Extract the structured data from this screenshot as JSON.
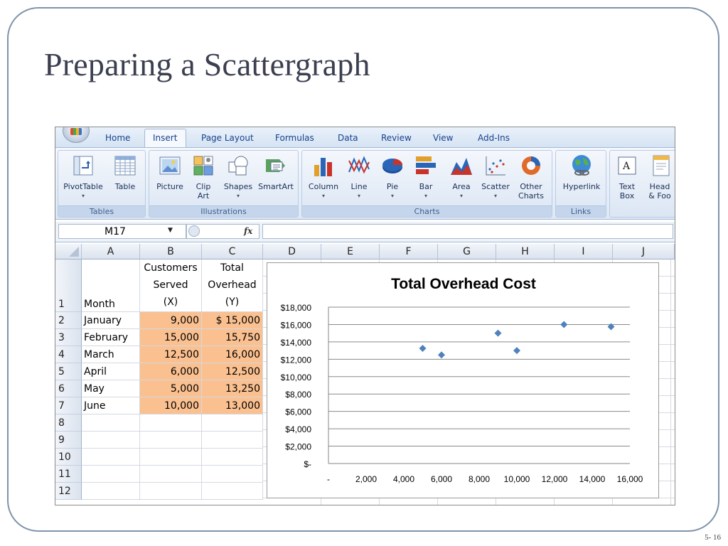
{
  "slide": {
    "title": "Preparing a Scattergraph",
    "page_number": "5- 16"
  },
  "tabs": [
    "Home",
    "Insert",
    "Page Layout",
    "Formulas",
    "Data",
    "Review",
    "View",
    "Add-Ins"
  ],
  "ribbon": {
    "groups": [
      "Tables",
      "Illustrations",
      "Charts",
      "Links"
    ],
    "pivottable": "PivotTable",
    "table": "Table",
    "picture": "Picture",
    "clipart": "Clip Art",
    "shapes": "Shapes",
    "smartart": "SmartArt",
    "column": "Column",
    "line": "Line",
    "pie": "Pie",
    "bar": "Bar",
    "area": "Area",
    "scatter": "Scatter",
    "other_charts": "Other Charts",
    "hyperlink": "Hyperlink",
    "textbox": "Text Box",
    "header_footer": "Head & Foo"
  },
  "formula_bar": {
    "name_box": "M17",
    "fx": "fx"
  },
  "columns": [
    "A",
    "B",
    "C",
    "D",
    "E",
    "F",
    "G",
    "H",
    "I",
    "J"
  ],
  "row_numbers": [
    "1",
    "2",
    "3",
    "4",
    "5",
    "6",
    "7",
    "8",
    "9",
    "10",
    "11",
    "12"
  ],
  "header_cells": {
    "a1": "Month",
    "b1": [
      "Customers",
      "Served",
      "(X)"
    ],
    "c1": [
      "Total",
      "Overhead",
      "(Y)"
    ]
  },
  "rows": [
    {
      "month": "January",
      "x": "9,000",
      "y": "$ 15,000"
    },
    {
      "month": "February",
      "x": "15,000",
      "y": "15,750"
    },
    {
      "month": "March",
      "x": "12,500",
      "y": "16,000"
    },
    {
      "month": "April",
      "x": "6,000",
      "y": "12,500"
    },
    {
      "month": "May",
      "x": "5,000",
      "y": "13,250"
    },
    {
      "month": "June",
      "x": "10,000",
      "y": "13,000"
    }
  ],
  "colors": {
    "highlight": "#fac090",
    "series": "#4f81bd",
    "ribbon_text": "#15428b"
  },
  "chart_data": {
    "type": "scatter",
    "title": "Total Overhead Cost",
    "xlabel": "",
    "ylabel": "",
    "x_ticks": [
      "-",
      "2,000",
      "4,000",
      "6,000",
      "8,000",
      "10,000",
      "12,000",
      "14,000",
      "16,000"
    ],
    "y_ticks": [
      "$-",
      "$2,000",
      "$4,000",
      "$6,000",
      "$8,000",
      "$10,000",
      "$12,000",
      "$14,000",
      "$16,000",
      "$18,000"
    ],
    "xlim": [
      0,
      16000
    ],
    "ylim": [
      0,
      18000
    ],
    "grid": "horizontal",
    "series": [
      {
        "points": [
          {
            "x": 9000,
            "y": 15000
          },
          {
            "x": 15000,
            "y": 15750
          },
          {
            "x": 12500,
            "y": 16000
          },
          {
            "x": 6000,
            "y": 12500
          },
          {
            "x": 5000,
            "y": 13250
          },
          {
            "x": 10000,
            "y": 13000
          }
        ]
      }
    ]
  }
}
